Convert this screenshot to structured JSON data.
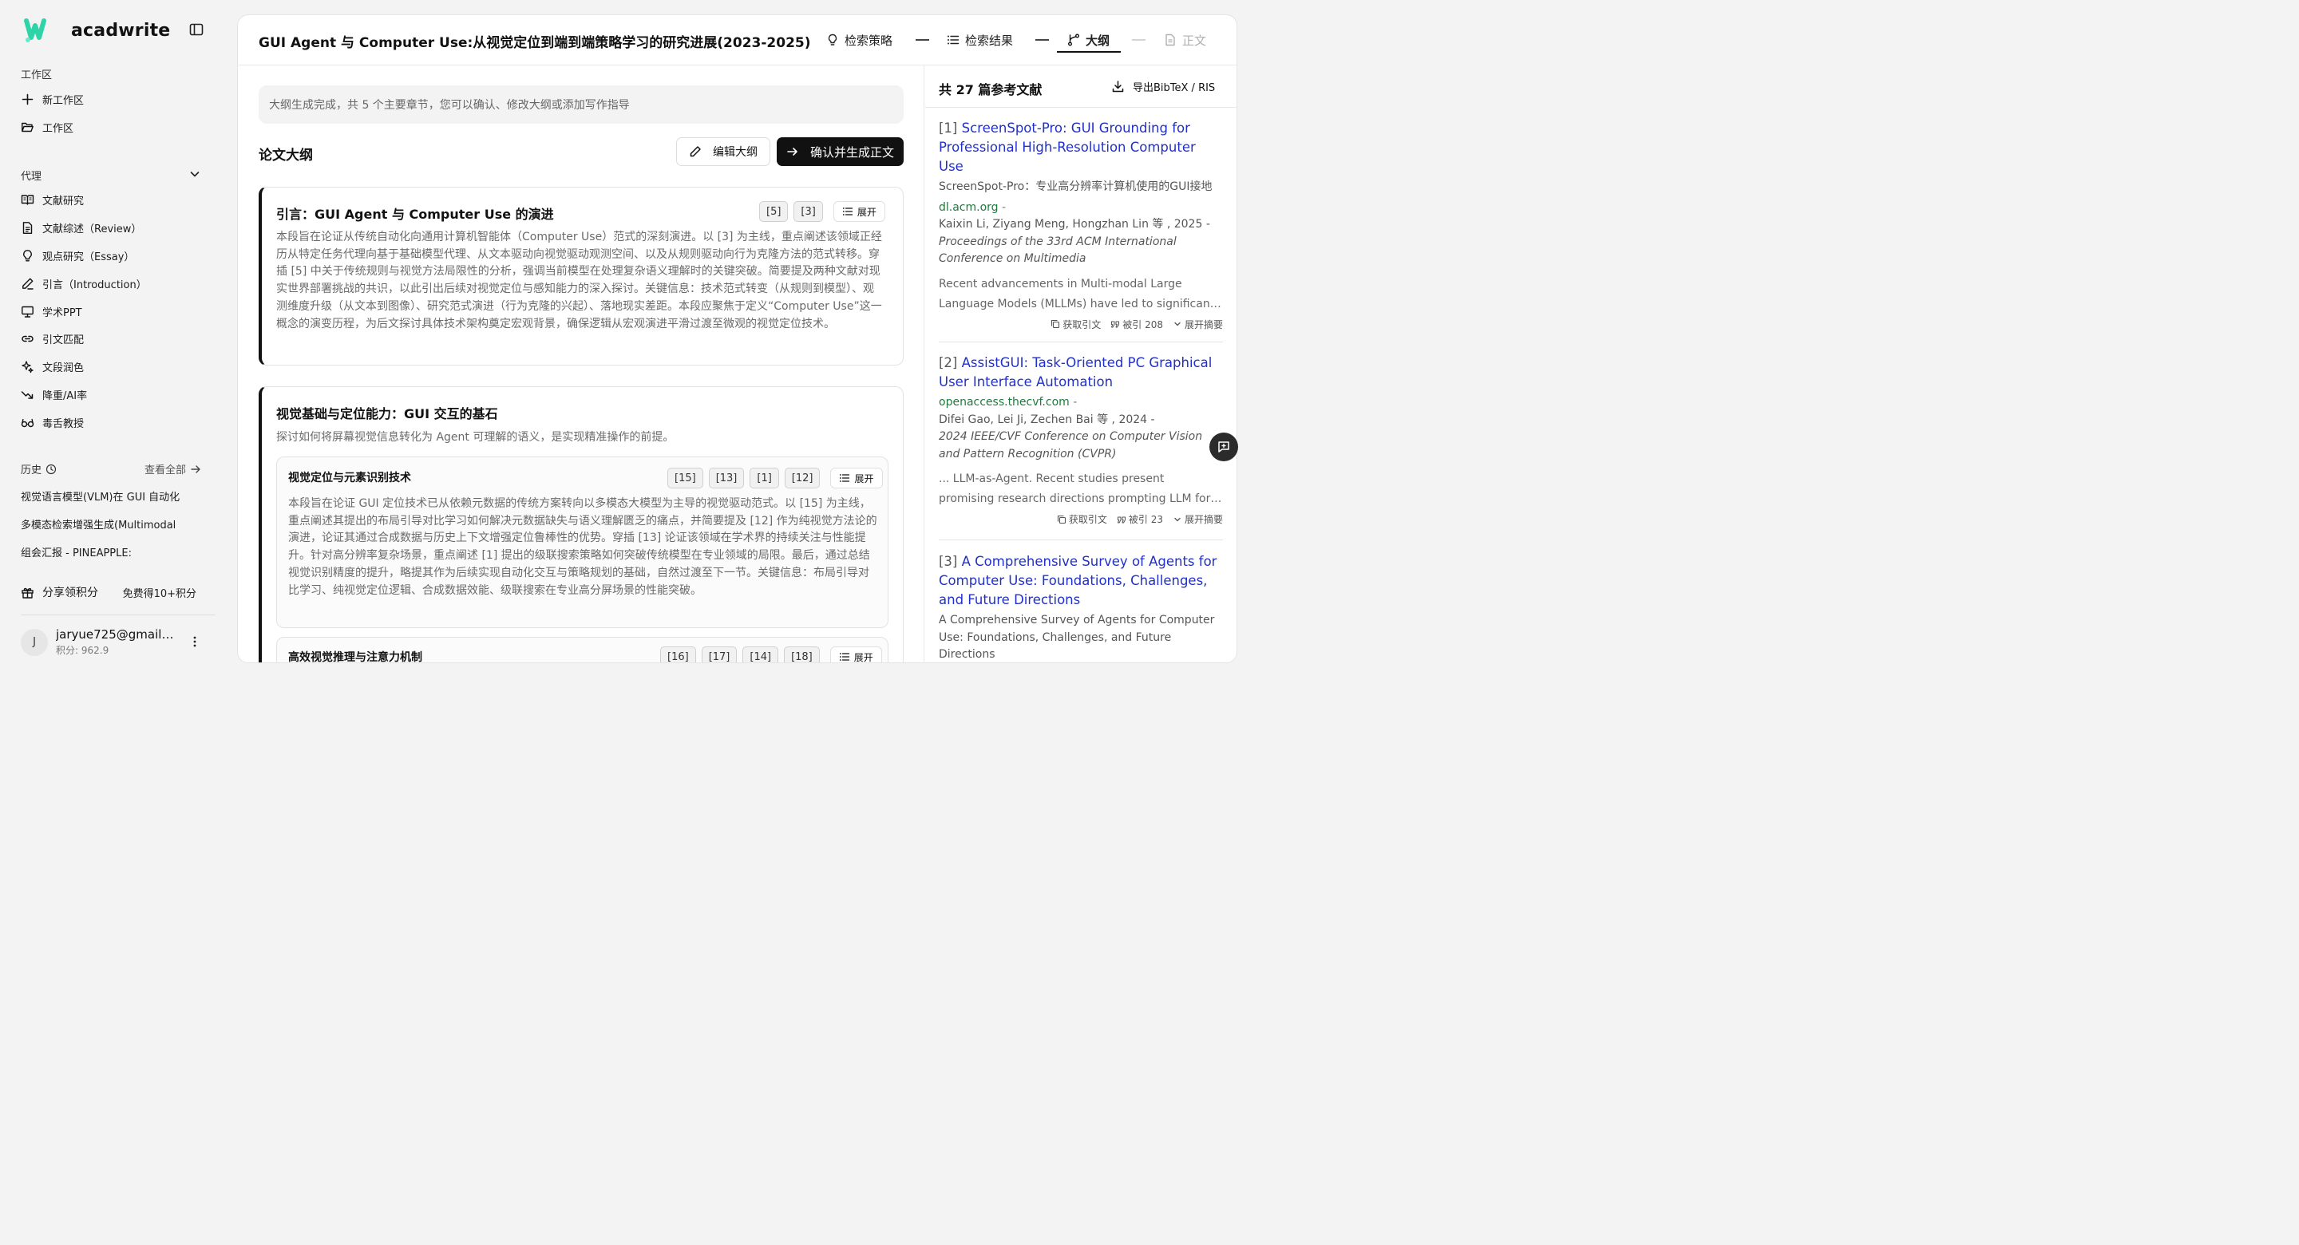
{
  "app": {
    "name": "acadwrite"
  },
  "sidebar": {
    "workspace_label": "工作区",
    "new_workspace": "新工作区",
    "workspace": "工作区",
    "agent_label": "代理",
    "agents": [
      {
        "label": "文献研究",
        "icon": "book-open-icon"
      },
      {
        "label": "文献综述（Review）",
        "icon": "document-icon"
      },
      {
        "label": "观点研究（Essay）",
        "icon": "lightbulb-icon"
      },
      {
        "label": "引言（Introduction）",
        "icon": "pen-icon"
      },
      {
        "label": "学术PPT",
        "icon": "presentation-icon"
      },
      {
        "label": "引文匹配",
        "icon": "link-icon"
      },
      {
        "label": "文段润色",
        "icon": "sparkles-icon"
      },
      {
        "label": "降重/AI率",
        "icon": "trend-down-icon"
      },
      {
        "label": "毒舌教授",
        "icon": "glasses-icon"
      }
    ],
    "history_label": "历史",
    "view_all": "查看全部",
    "history": [
      "视觉语言模型(VLM)在 GUI 自动化",
      "多模态检索增强生成(Multimodal",
      "组会汇报 - PINEAPPLE:"
    ],
    "share_label": "分享领积分",
    "share_reward": "免费得10+积分",
    "user": {
      "initial": "J",
      "email": "jaryue725@gmail.com",
      "points": "积分: 962.9"
    }
  },
  "header": {
    "title": "GUI Agent 与 Computer Use:从视觉定位到端到端策略学习的研究进展(2023-2025)",
    "steps": [
      {
        "label": "检索策略",
        "state": "done"
      },
      {
        "label": "检索结果",
        "state": "done"
      },
      {
        "label": "大纲",
        "state": "active"
      },
      {
        "label": "正文",
        "state": "disabled"
      }
    ]
  },
  "outline": {
    "notice": "大纲生成完成，共 5 个主要章节，您可以确认、修改大纲或添加写作指导",
    "title": "论文大纲",
    "edit_button": "编辑大纲",
    "confirm_button": "确认并生成正文",
    "expand_label": "展开",
    "sections": [
      {
        "title": "引言：GUI Agent 与 Computer Use 的演进",
        "refs": [
          "[5]",
          "[3]"
        ],
        "body": "本段旨在论证从传统自动化向通用计算机智能体（Computer Use）范式的深刻演进。以 [3] 为主线，重点阐述该领域正经历从特定任务代理向基于基础模型代理、从文本驱动向视觉驱动观测空间、以及从规则驱动向行为克隆方法的范式转移。穿插 [5] 中关于传统规则与视觉方法局限性的分析，强调当前模型在处理复杂语义理解时的关键突破。简要提及两种文献对现实世界部署挑战的共识，以此引出后续对视觉定位与感知能力的深入探讨。关键信息：技术范式转变（从规则到模型）、观测维度升级（从文本到图像）、研究范式演进（行为克隆的兴起）、落地现实差距。本段应聚焦于定义“Computer Use”这一概念的演变历程，为后文探讨具体技术架构奠定宏观背景，确保逻辑从宏观演进平滑过渡至微观的视觉定位技术。"
      },
      {
        "title": "视觉基础与定位能力：GUI 交互的基石",
        "subtitle": "探讨如何将屏幕视觉信息转化为 Agent 可理解的语义，是实现精准操作的前提。",
        "subsections": [
          {
            "title": "视觉定位与元素识别技术",
            "refs": [
              "[15]",
              "[13]",
              "[1]",
              "[12]"
            ],
            "body": "本段旨在论证 GUI 定位技术已从依赖元数据的传统方案转向以多模态大模型为主导的视觉驱动范式。以 [15] 为主线，重点阐述其提出的布局引导对比学习如何解决元数据缺失与语义理解匮乏的痛点，并简要提及 [12] 作为纯视觉方法论的演进，论证其通过合成数据与历史上下文增强定位鲁棒性的优势。穿插 [13] 论证该领域在学术界的持续关注与性能提升。针对高分辨率复杂场景，重点阐述 [1] 提出的级联搜索策略如何突破传统模型在专业领域的局限。最后，通过总结视觉识别精度的提升，略提其作为后续实现自动化交互与策略规划的基础，自然过渡至下一节。关键信息：布局引导对比学习、纯视觉定位逻辑、合成数据效能、级联搜索在专业高分屏场景的性能突破。"
          },
          {
            "title": "高效视觉推理与注意力机制",
            "refs": [
              "[16]",
              "[17]",
              "[14]",
              "[18]"
            ]
          }
        ]
      }
    ]
  },
  "references": {
    "count_label": "共 27 篇参考文献",
    "export_label": "导出BibTeX / RIS",
    "action_cite": "获取引文",
    "action_expand": "展开摘要",
    "items": [
      {
        "num": "[1]",
        "title": "ScreenSpot-Pro: GUI Grounding for Professional High-Resolution Computer Use",
        "subtitle": "ScreenSpot-Pro：专业高分辨率计算机使用的GUI接地",
        "source": "dl.acm.org",
        "authors": "Kaixin Li, Ziyang Meng, Hongzhan Lin 等 , 2025 -",
        "venue": "Proceedings of the 33rd ACM International Conference on Multimedia",
        "abstract_line1": "Recent advancements in Multi-modal Large",
        "abstract_line2": "Language Models (MLLMs) have led to significant progress",
        "citations": "被引 208"
      },
      {
        "num": "[2]",
        "title": "AssistGUI: Task-Oriented PC Graphical User Interface Automation",
        "source": "openaccess.thecvf.com",
        "authors": "Difei Gao, Lei Ji, Zechen Bai 等 , 2024 -",
        "venue": "2024 IEEE/CVF Conference on Computer Vision and Pattern Recognition (CVPR)",
        "abstract_line1": "... LLM-as-Agent. Recent studies present",
        "abstract_line2": "promising research directions prompting LLM for automation",
        "citations": "被引 23"
      },
      {
        "num": "[3]",
        "title": "A Comprehensive Survey of Agents for Computer Use: Foundations, Challenges, and Future Directions",
        "subtitle": "A Comprehensive Survey of Agents for Computer Use: Foundations, Challenges, and Future Directions"
      }
    ]
  },
  "colors": {
    "accent": "#111111",
    "link": "#2130c8",
    "source": "#1e7a3c",
    "logo": "#2dd4a8"
  }
}
